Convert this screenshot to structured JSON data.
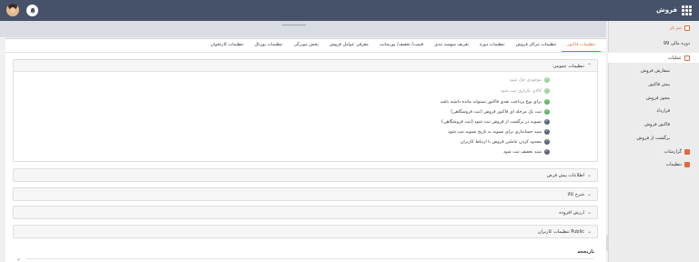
{
  "topbar": {
    "app_title": "فروش",
    "apps_icon": "grid-icon",
    "notification_icon": "bell-icon",
    "avatar_icon": "user-avatar"
  },
  "sidebar": {
    "items": [
      {
        "label": "تیم یار",
        "icon": "user-icon"
      },
      {
        "label": "دوره مالی 99"
      },
      {
        "label": "عملیات",
        "icon": "minus-box-icon",
        "active": true
      },
      {
        "label": "سفارش فروش"
      },
      {
        "label": "پیش فاکتور"
      },
      {
        "label": "مجوز فروش"
      },
      {
        "label": "قرارداد"
      },
      {
        "label": "فاکتور فروش"
      },
      {
        "label": "برگشت از فروش"
      },
      {
        "label": "گزارشات",
        "icon": "plus-box-icon"
      },
      {
        "label": "تنظیمات",
        "icon": "plus-box-icon"
      }
    ]
  },
  "tabs": [
    {
      "label": "تنظیمات فاکتور",
      "active": true
    },
    {
      "label": "تنظیمات مراکز فروش"
    },
    {
      "label": "تنظیمات دوره"
    },
    {
      "label": "تعریف سهمیه بندی"
    },
    {
      "label": "قیمت/ تخفیف/ پورسانت"
    },
    {
      "label": "معرفی عوامل فروش"
    },
    {
      "label": "پخش مویرگی"
    },
    {
      "label": "تنظیمات پورتال"
    },
    {
      "label": "تنظیمات کارتخوان"
    }
  ],
  "sections": {
    "general": {
      "title": "تنظیمات عمومی",
      "options": [
        {
          "label": "موجودی چک شود",
          "state": "disabled"
        },
        {
          "label": "کالای تکراری ثبت شود",
          "state": "disabled"
        },
        {
          "label": "برای نوع پرداخت نقدی فاکتور نمیتواند مانده داشته باشد",
          "state": "checked"
        },
        {
          "label": "ثبت یک مرحله ای فاکتور فروش (ثبت فروشگاهی)",
          "state": "checked"
        },
        {
          "label": "تسویه در برگشت از فروش ثبت شود (ثبت فروشگاهی)",
          "state": "unchecked"
        },
        {
          "label": "سند حسابداری برای تسویه به تاریخ تسویه ثبت شود",
          "state": "unchecked"
        },
        {
          "label": "محدود کردن عاملین فروش با ارتباط کاربران",
          "state": "unchecked"
        },
        {
          "label": "سند تخفیف ثبت شود",
          "state": "unchecked"
        }
      ]
    },
    "collapsed": [
      {
        "title": "اطلاعات پیش فرض"
      },
      {
        "title": "شرح کالا"
      },
      {
        "title": "ارزش افزوده"
      },
      {
        "title": "تنظیمات کاربران Public"
      }
    ],
    "history": {
      "title": "تاریخچه"
    }
  },
  "colors": {
    "topbar": "#46526a",
    "accent": "#e06a3b",
    "check_green": "#5cb85c",
    "check_blue": "#5a6475"
  }
}
